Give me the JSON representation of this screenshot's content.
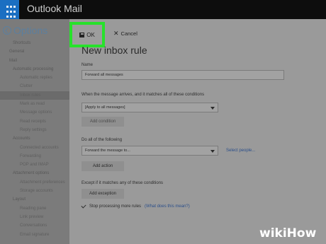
{
  "app": {
    "title": "Outlook Mail",
    "icon": "app-launcher-grid-icon"
  },
  "sidebar": {
    "heading": "Options",
    "items": [
      {
        "label": "Shortcuts",
        "level": 1
      },
      {
        "label": "General",
        "level": 0
      },
      {
        "label": "Mail",
        "level": 0
      },
      {
        "label": "Automatic processing",
        "level": 1
      },
      {
        "label": "Automatic replies",
        "level": 2
      },
      {
        "label": "Clutter",
        "level": 2
      },
      {
        "label": "Inbox rules",
        "level": 2,
        "selected": true
      },
      {
        "label": "Mark as read",
        "level": 2
      },
      {
        "label": "Message options",
        "level": 2
      },
      {
        "label": "Read receipts",
        "level": 2
      },
      {
        "label": "Reply settings",
        "level": 2
      },
      {
        "label": "Accounts",
        "level": 1
      },
      {
        "label": "Connected accounts",
        "level": 2
      },
      {
        "label": "Forwarding",
        "level": 2
      },
      {
        "label": "POP and IMAP",
        "level": 2
      },
      {
        "label": "Attachment options",
        "level": 1
      },
      {
        "label": "Attachment preferences",
        "level": 2
      },
      {
        "label": "Storage accounts",
        "level": 2
      },
      {
        "label": "Layout",
        "level": 1
      },
      {
        "label": "Reading pane",
        "level": 2
      },
      {
        "label": "Link preview",
        "level": 2
      },
      {
        "label": "Conversations",
        "level": 2
      },
      {
        "label": "Email signature",
        "level": 2
      }
    ]
  },
  "toolbar": {
    "ok_label": "OK",
    "cancel_label": "Cancel"
  },
  "form": {
    "title": "New inbox rule",
    "name_label": "Name",
    "name_value": "Forward all messages",
    "condition_label": "When the message arrives, and it matches all of these conditions",
    "condition_value": "[Apply to all messages]",
    "add_condition": "Add condition",
    "action_label": "Do all of the following",
    "action_value": "Forward the message to...",
    "select_people": "Select people...",
    "add_action": "Add action",
    "exception_label": "Except if it matches any of these conditions",
    "add_exception": "Add exception",
    "stop_processing": "Stop processing more rules",
    "what_does_this_mean": "(What does this mean?)"
  },
  "watermark": "wikiHow",
  "colors": {
    "highlight": "#27e22b",
    "app_launcher": "#1b6fc2",
    "topbar": "#0d0d0d"
  }
}
